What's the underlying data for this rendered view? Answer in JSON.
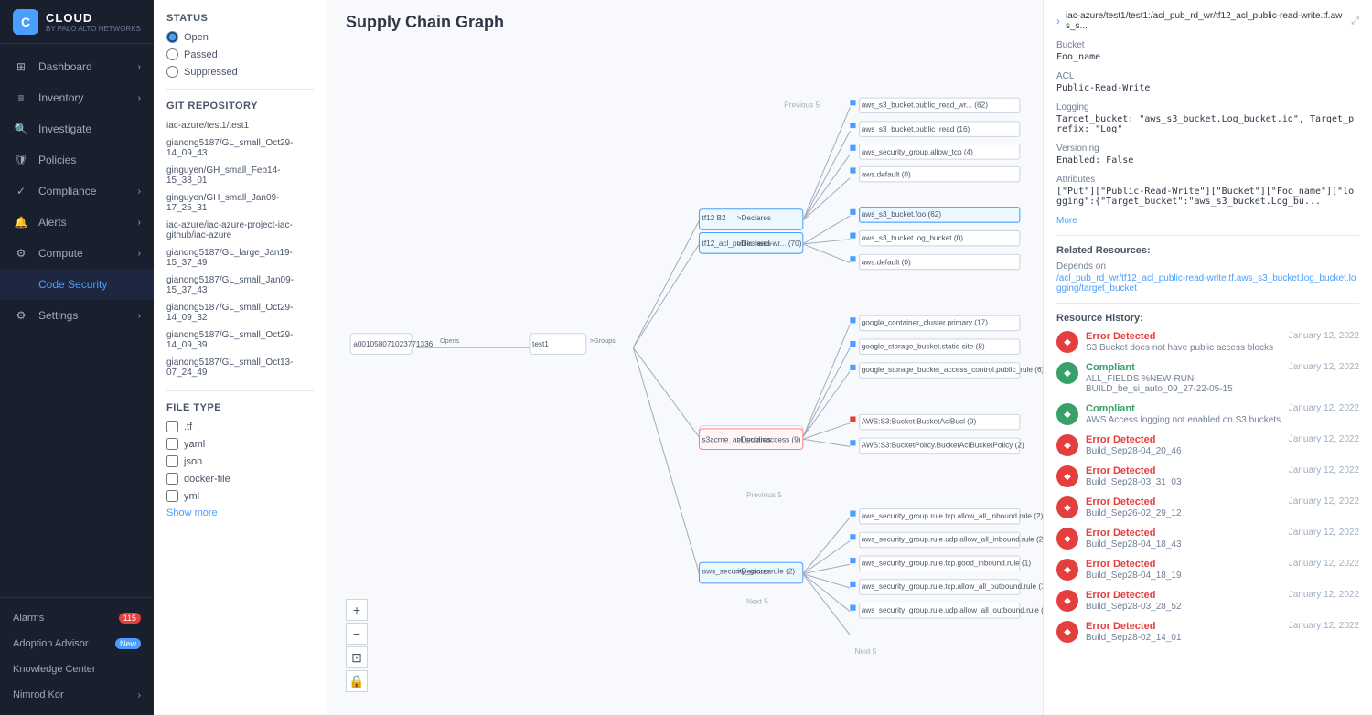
{
  "app": {
    "logo": "C",
    "name": "CLOUD",
    "sub": "BY PALO ALTO NETWORKS"
  },
  "sidebar": {
    "items": [
      {
        "id": "dashboard",
        "label": "Dashboard",
        "icon": "⊞",
        "hasArrow": true,
        "active": false
      },
      {
        "id": "inventory",
        "label": "Inventory",
        "icon": "≡",
        "hasArrow": true,
        "active": false
      },
      {
        "id": "investigate",
        "label": "Investigate",
        "icon": "🔍",
        "hasArrow": false,
        "active": false
      },
      {
        "id": "policies",
        "label": "Policies",
        "icon": "🛡",
        "hasArrow": false,
        "active": false
      },
      {
        "id": "compliance",
        "label": "Compliance",
        "icon": "✓",
        "hasArrow": true,
        "active": false
      },
      {
        "id": "alerts",
        "label": "Alerts",
        "icon": "🔔",
        "hasArrow": true,
        "active": false
      },
      {
        "id": "compute",
        "label": "Compute",
        "icon": "⚙",
        "hasArrow": true,
        "active": false
      },
      {
        "id": "code-security",
        "label": "Code Security",
        "icon": "</>",
        "hasArrow": false,
        "active": true
      },
      {
        "id": "settings",
        "label": "Settings",
        "icon": "⚙",
        "hasArrow": true,
        "active": false
      }
    ],
    "bottom": [
      {
        "id": "alarms",
        "label": "Alarms",
        "badge": "115"
      },
      {
        "id": "adoption",
        "label": "Adoption Advisor",
        "badge_new": "New"
      },
      {
        "id": "knowledge",
        "label": "Knowledge Center"
      },
      {
        "id": "nimrod",
        "label": "Nimrod Kor",
        "hasArrow": true
      }
    ]
  },
  "filters": {
    "status_title": "Status",
    "status_options": [
      {
        "label": "Open",
        "selected": true
      },
      {
        "label": "Passed",
        "selected": false
      },
      {
        "label": "Suppressed",
        "selected": false
      }
    ],
    "git_repo_title": "Git Repository",
    "repos": [
      "iac-azure/test1/test1",
      "gianqng5187/GL_small_Oct29-14_09_43",
      "ginguyen/GH_small_Feb14-15_38_01",
      "ginguyen/GH_small_Jan09-17_25_31",
      "iac-azure/iac-azure-project-iac-github/iac-azure",
      "gianqng5187/GL_large_Jan19-15_37_49",
      "gianqng5187/GL_small_Jan09-15_37_43",
      "gianqng5187/GL_small_Oct29-14_09_32",
      "gianqng5187/GL_small_Oct29-14_09_39",
      "gianqng5187/GL_small_Oct13-07_24_49"
    ],
    "file_type_title": "FILE TYPE",
    "file_types": [
      {
        "label": ".tf",
        "checked": false
      },
      {
        "label": "yaml",
        "checked": false
      },
      {
        "label": "json",
        "checked": false
      },
      {
        "label": "docker-file",
        "checked": false
      },
      {
        "label": "yml",
        "checked": false
      }
    ],
    "show_more": "Show more"
  },
  "graph": {
    "title": "Supply Chain Graph",
    "controls": [
      "+",
      "−",
      "⊡",
      "🔒"
    ]
  },
  "right_panel": {
    "chevron": "›",
    "path": "iac-azure/test1/test1:/acl_pub_rd_wr/tf12_acl_public-read-write.tf.aws_s...",
    "expand_icon": "⤢",
    "sections": [
      {
        "label": "Bucket",
        "value": "Foo_name"
      },
      {
        "label": "ACL",
        "value": "Public-Read-Write"
      },
      {
        "label": "Logging",
        "value": "Target_bucket: \"aws_s3_bucket.Log_bucket.id\", Target_prefix: \"Log\""
      },
      {
        "label": "Versioning",
        "value": "Enabled: False"
      },
      {
        "label": "Attributes",
        "value": "[\"Put\"][\"Public-Read-Write\"][\"Bucket\"][\"Foo_name\"][\"logging\":{\"Target_bucket\":\"aws_s3_bucket.Log_bu..."
      }
    ],
    "more_label": "More",
    "related_title": "Related Resources:",
    "depends_on_label": "Depends on",
    "depends_on": [
      "/acl_pub_rd_wr/tf12_acl_public-read-write.tf.aws_s3_bucket.log_bucket.logging/target_bucket"
    ],
    "history_title": "Resource History:",
    "history": [
      {
        "status": "Error Detected",
        "type": "error",
        "desc": "S3 Bucket does not have public access blocks",
        "date": "January 12, 2022"
      },
      {
        "status": "Compliant",
        "type": "compliant",
        "desc": "ALL_FIELDS %NEW-RUN-BUILD_be_si_auto_09_27-22-05-15",
        "date": "January 12, 2022"
      },
      {
        "status": "Compliant",
        "type": "compliant",
        "desc": "AWS Access logging not enabled on S3 buckets",
        "date": "January 12, 2022"
      },
      {
        "status": "Error Detected",
        "type": "error",
        "desc": "Build_Sep28-04_20_46",
        "date": "January 12, 2022"
      },
      {
        "status": "Error Detected",
        "type": "error",
        "desc": "Build_Sep28-03_31_03",
        "date": "January 12, 2022"
      },
      {
        "status": "Error Detected",
        "type": "error",
        "desc": "Build_Sep26-02_29_12",
        "date": "January 12, 2022"
      },
      {
        "status": "Error Detected",
        "type": "error",
        "desc": "Build_Sep28-04_18_43",
        "date": "January 12, 2022"
      },
      {
        "status": "Error Detected",
        "type": "error",
        "desc": "Build_Sep28-04_18_19",
        "date": "January 12, 2022"
      },
      {
        "status": "Error Detected",
        "type": "error",
        "desc": "Build_Sep28-03_28_52",
        "date": "January 12, 2022"
      },
      {
        "status": "Error Detected",
        "type": "error",
        "desc": "Build_Sep28-02_14_01",
        "date": "January 12, 2022"
      }
    ]
  }
}
